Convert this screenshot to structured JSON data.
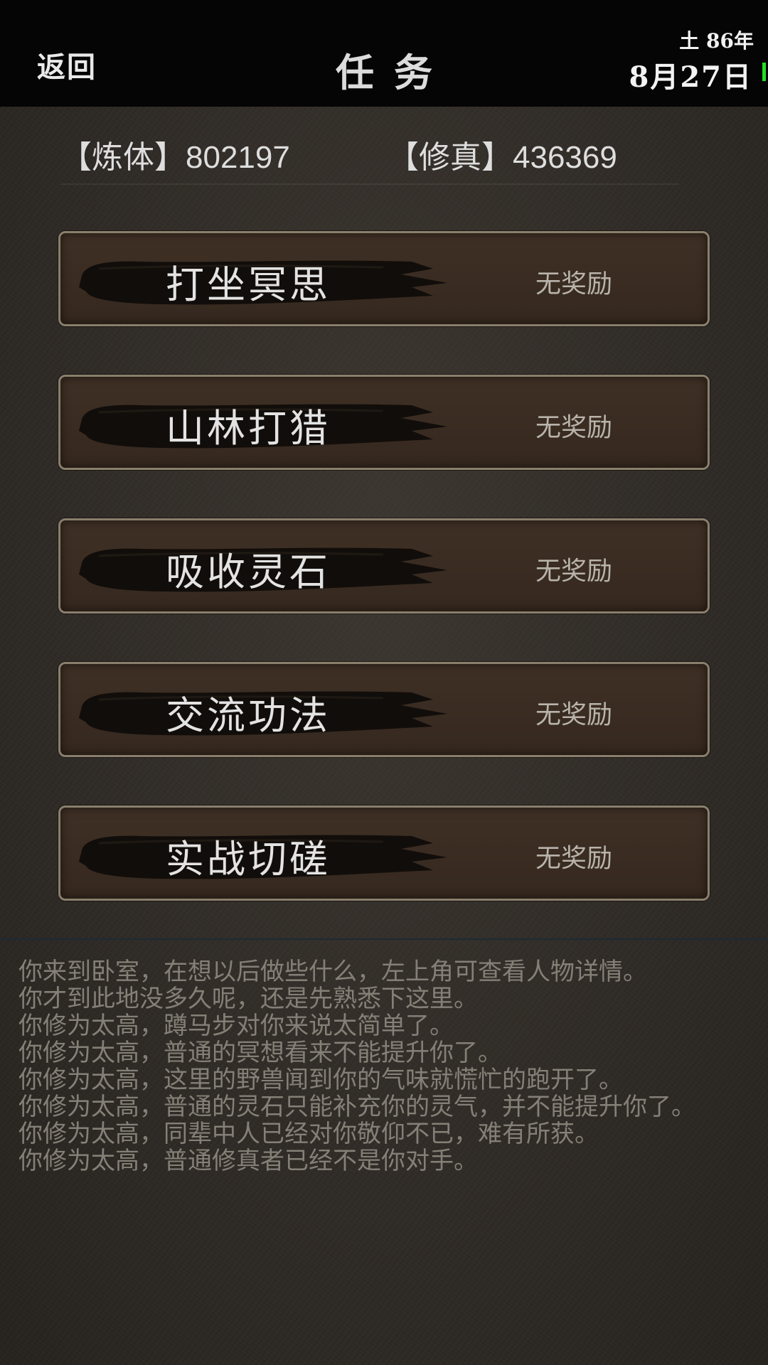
{
  "header": {
    "back_label": "返回",
    "title": "任务",
    "date_year": "土 86年",
    "date_day": "8月27日",
    "battery_color": "#22e022"
  },
  "stats": {
    "body_label": "【炼体】802197",
    "cultivation_label": "【修真】436369"
  },
  "tasks": [
    {
      "name": "打坐冥思",
      "reward": "无奖励"
    },
    {
      "name": "山林打猎",
      "reward": "无奖励"
    },
    {
      "name": "吸收灵石",
      "reward": "无奖励"
    },
    {
      "name": "交流功法",
      "reward": "无奖励"
    },
    {
      "name": "实战切磋",
      "reward": "无奖励"
    }
  ],
  "log": [
    "你来到卧室，在想以后做些什么，左上角可查看人物详情。",
    "你才到此地没多久呢，还是先熟悉下这里。",
    "你修为太高，蹲马步对你来说太简单了。",
    "你修为太高，普通的冥想看来不能提升你了。",
    "你修为太高，这里的野兽闻到你的气味就慌忙的跑开了。",
    "你修为太高，普通的灵石只能补充你的灵气，并不能提升你了。",
    "你修为太高，同辈中人已经对你敬仰不已，难有所获。",
    "你修为太高，普通修真者已经不是你对手。"
  ],
  "colors": {
    "button_border": "#8a7f6c",
    "button_fill": "#3a2c22",
    "brush_ink": "#0e0b09",
    "log_text": "#858077"
  }
}
